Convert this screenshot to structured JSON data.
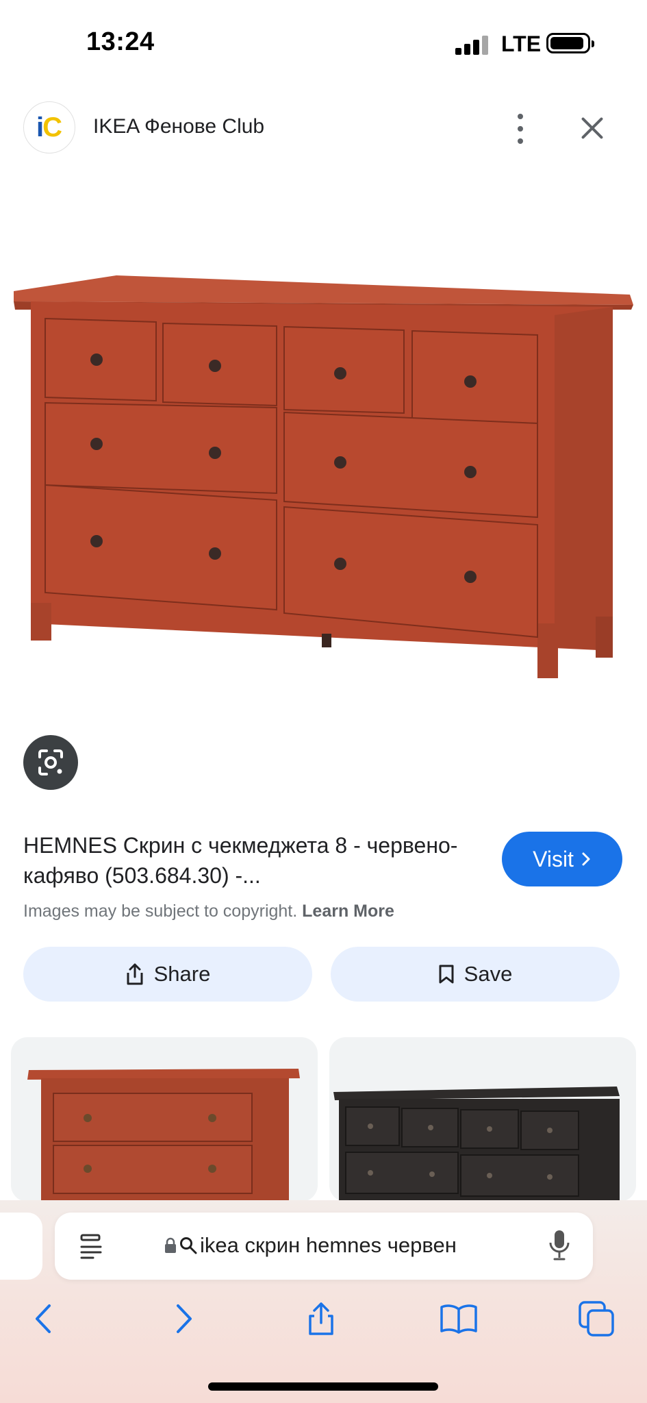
{
  "status_bar": {
    "time": "13:24",
    "network": "LTE",
    "icons": [
      "signal-icon",
      "battery-icon"
    ]
  },
  "source": {
    "logo_text_i": "i",
    "logo_text_c": "C",
    "name": "IKEA Фенове Club"
  },
  "result": {
    "title": "HEMNES Скрин с чекмеджета 8 - червено-кафяво (503.684.30) -...",
    "visit_label": "Visit",
    "copyright_text": "Images may be subject to copyright.",
    "learn_more_label": "Learn More",
    "share_label": "Share",
    "save_label": "Save"
  },
  "browser": {
    "url_text": "ikea скрин hemnes червен"
  },
  "colors": {
    "accent": "#1a73e8",
    "action_bg": "#e8f0fe",
    "dresser_red": "#b8482e",
    "dresser_dark": "#2b2b2b"
  },
  "icons": {
    "lens": "google-lens-icon",
    "more": "more-vert-icon",
    "close": "close-icon",
    "share": "share-icon",
    "save": "bookmark-icon",
    "reader": "reader-icon",
    "lock": "lock-icon",
    "search": "search-icon",
    "mic": "mic-icon",
    "back": "back-icon",
    "forward": "forward-icon",
    "share_browser": "share-icon",
    "bookmarks": "bookmarks-icon",
    "tabs": "tabs-icon"
  }
}
